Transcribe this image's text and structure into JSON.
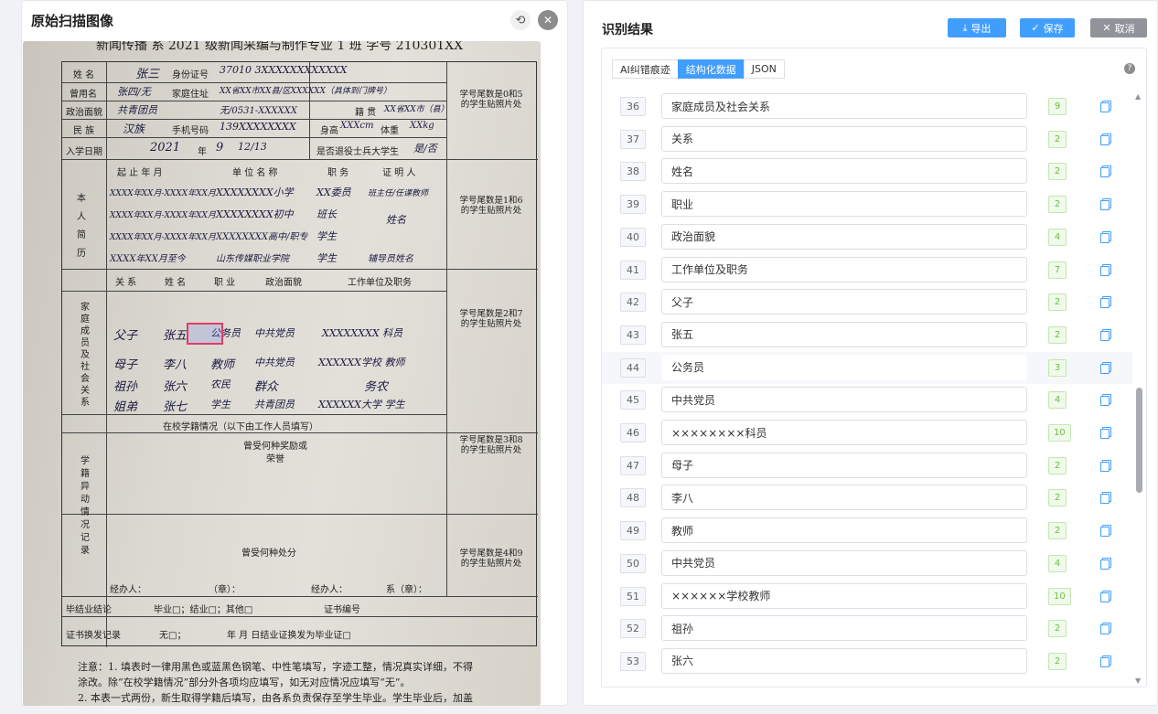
{
  "left": {
    "title": "原始扫描图像",
    "rotate_icon": "rotate-icon",
    "close_icon": "close-icon",
    "scan": {
      "top_line": "新闻传播 系 2021 级新闻采编与制作专业 1 班    学号 210301XX",
      "labels": {
        "name": "姓 名",
        "id_card": "身份证号",
        "former_name": "曾用名",
        "home_address": "家庭住址",
        "political": "政治面貌",
        "native": "籍 贯",
        "ethnic": "民 族",
        "phone": "手机号码",
        "height": "身高",
        "weight": "体重",
        "enroll": "入学日期",
        "year": "年",
        "month": "月",
        "day": "日",
        "veteran": "是否退役士兵大学生",
        "resume_section": "本人简历",
        "period": "起 止 年 月",
        "unit": "单 位 名 称",
        "position": "职 务",
        "witness": "证 明 人",
        "family_section": "家庭成员及社会关系",
        "relation": "关 系",
        "fname": "姓 名",
        "job": "职 业",
        "fpolitical": "政治面貌",
        "fwork": "工作单位及职务",
        "school_status": "在校学籍情况（以下由工作人员填写）",
        "change_section": "学籍异动情况记录",
        "awards": "曾受何种奖励或荣誉",
        "punish": "曾受何种处分",
        "handler": "经办人：",
        "seal": "（章）：",
        "dept_seal": "系（章）：",
        "graduation": "毕结业结论",
        "grad_options": "毕业□；结业□；其他□",
        "cert_no": "证书编号",
        "cert_change": "证书换发记录",
        "none_box": "无□；",
        "cert_change_text": "年    月    日结业证换发为毕业证□"
      },
      "photo_notes": [
        "学号尾数是0和5的学生贴照片处",
        "学号尾数是1和6的学生贴照片处",
        "学号尾数是2和7的学生贴照片处",
        "学号尾数是3和8的学生贴照片处",
        "学号尾数是4和9的学生贴照片处"
      ],
      "hand": {
        "name": "张三",
        "id": "37010 3XXXXXXXXXXXX",
        "former": "张四/无",
        "address": "XX省XX市XX县/区XXXXXX（具体到门牌号）",
        "political": "共青团员",
        "home_phone": "无/0531-XXXXXX",
        "native": "XX省XX市（县）",
        "ethnic": "汉族",
        "mobile": "139XXXXXXXX",
        "height": "XXXcm",
        "weight": "XXkg",
        "enroll_year": "2021",
        "enroll_month": "9",
        "enroll_day": "12/13",
        "veteran": "是/否",
        "resume": [
          [
            "XXXX年XX月-XXXX年XX月",
            "XXXXXXXX小学",
            "XX委员",
            "班主任/任课教师"
          ],
          [
            "XXXX年XX月-XXXX年XX月",
            "XXXXXXXX初中",
            "班长",
            "姓名"
          ],
          [
            "XXXX年XX月-XXXX年XX月",
            "XXXXXXXX高中/职专",
            "学生",
            ""
          ],
          [
            "XXXX年XX月至今",
            "山东传媒职业学院",
            "学生",
            "辅导员姓名"
          ]
        ],
        "family": [
          [
            "父子",
            "张五",
            "公务员",
            "中共党员",
            "XXXXXXXX 科员"
          ],
          [
            "母子",
            "李八",
            "教师",
            "中共党员",
            "XXXXXX学校 教师"
          ],
          [
            "祖孙",
            "张六",
            "农民",
            "群众",
            "务农"
          ],
          [
            "姐弟",
            "张七",
            "学生",
            "共青团员",
            "XXXXXX大学 学生"
          ]
        ]
      },
      "notes_line1": "注意：1. 填表时一律用黑色或蓝黑色钢笔、中性笔填写，字迹工整，情况真实详细，不得",
      "notes_line2": "涂改。除“在校学籍情况”部分外各项均应填写，如无对应情况应填写“无”。",
      "notes_line3": "2. 本表一式两份，新生取得学籍后填写，由各系负责保存至学生毕业。学生毕业后，加盖"
    }
  },
  "right": {
    "title": "识别结果",
    "export_label": "导出",
    "save_label": "保存",
    "cancel_label": "取消",
    "tabs": [
      "AI纠错痕迹",
      "结构化数据",
      "JSON"
    ],
    "active_tab": 1,
    "rows": [
      {
        "n": "36",
        "v": "家庭成员及社会关系",
        "c": "9"
      },
      {
        "n": "37",
        "v": "关系",
        "c": "2"
      },
      {
        "n": "38",
        "v": "姓名",
        "c": "2"
      },
      {
        "n": "39",
        "v": "职业",
        "c": "2"
      },
      {
        "n": "40",
        "v": "政治面貌",
        "c": "4"
      },
      {
        "n": "41",
        "v": "工作单位及职务",
        "c": "7"
      },
      {
        "n": "42",
        "v": "父子",
        "c": "2"
      },
      {
        "n": "43",
        "v": "张五",
        "c": "2"
      },
      {
        "n": "44",
        "v": "公务员",
        "c": "3"
      },
      {
        "n": "45",
        "v": "中共党员",
        "c": "4"
      },
      {
        "n": "46",
        "v": "××××××××科员",
        "c": "10"
      },
      {
        "n": "47",
        "v": "母子",
        "c": "2"
      },
      {
        "n": "48",
        "v": "李八",
        "c": "2"
      },
      {
        "n": "49",
        "v": "教师",
        "c": "2"
      },
      {
        "n": "50",
        "v": "中共党员",
        "c": "4"
      },
      {
        "n": "51",
        "v": "××××××学校教师",
        "c": "10"
      },
      {
        "n": "52",
        "v": "祖孙",
        "c": "2"
      },
      {
        "n": "53",
        "v": "张六",
        "c": "2"
      }
    ],
    "highlighted_row": 8,
    "colors": {
      "primary": "#409eff",
      "cancel": "#909399",
      "count_green": "#67c23a",
      "highlight_border": "#e03d62"
    }
  }
}
